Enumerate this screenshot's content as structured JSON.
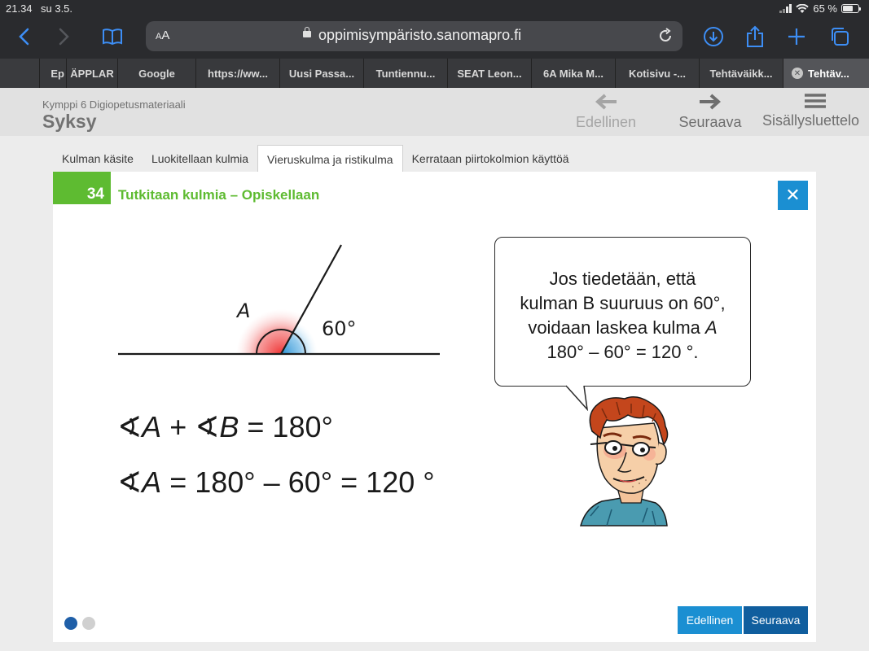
{
  "status": {
    "time": "21.34",
    "date": "su 3.5.",
    "battery": "65 %",
    "battery_level": 0.65
  },
  "browser": {
    "text_size_label": "AA",
    "url": "oppimisympäristo.sanomapro.fi",
    "icons": [
      "back-icon",
      "forward-icon",
      "bookmarks-icon",
      "reload-icon",
      "download-icon",
      "share-icon",
      "new-tab-icon",
      "tabs-icon"
    ],
    "accent": "#3d8ef5",
    "tabs": [
      {
        "label": "Ep"
      },
      {
        "label": "ÄPPLAR"
      },
      {
        "label": "Google"
      },
      {
        "label": "https://ww..."
      },
      {
        "label": "Uusi Passa..."
      },
      {
        "label": "Tuntiennu..."
      },
      {
        "label": "SEAT Leon..."
      },
      {
        "label": "6A Mika M..."
      },
      {
        "label": "Kotisivu -..."
      },
      {
        "label": "Tehtäväikk..."
      },
      {
        "label": "Tehtäv..."
      }
    ]
  },
  "header": {
    "course": "Kymppi 6 Digiopetusmateriaali",
    "title": "Syksy",
    "prev": "Edellinen",
    "next": "Seuraava",
    "toc": "Sisällysluettelo"
  },
  "content_tabs": [
    "Kulman käsite",
    "Luokitellaan kulmia",
    "Vieruskulma ja ristikulma",
    "Kerrataan piirtokolmion käyttöä"
  ],
  "active_tab": 2,
  "card": {
    "number": "34",
    "title": "Tutkitaan kulmia – Opiskellaan",
    "accent": "#5ebb31",
    "close_label": "✕",
    "figure": {
      "angle_label_a": "A",
      "angle_label_60": "60°"
    },
    "bubble": {
      "line1": "Jos tiedetään, että",
      "line2": "kulman B suuruus on 60°,",
      "line3_prefix": "voidaan laskea kulma ",
      "line3_var": "A",
      "line4": "180° – 60° = 120 °."
    },
    "formula1": {
      "sym1": "∢",
      "var1": "A",
      "op": " + ",
      "sym2": "∢",
      "var2": "B",
      "rest": " = 180°"
    },
    "formula2": {
      "sym": "∢",
      "var": "A",
      "rest": " = 180° – 60° = 120 °"
    },
    "pages": 2,
    "current_page": 1,
    "prev_button": "Edellinen",
    "next_button": "Seuraava"
  }
}
